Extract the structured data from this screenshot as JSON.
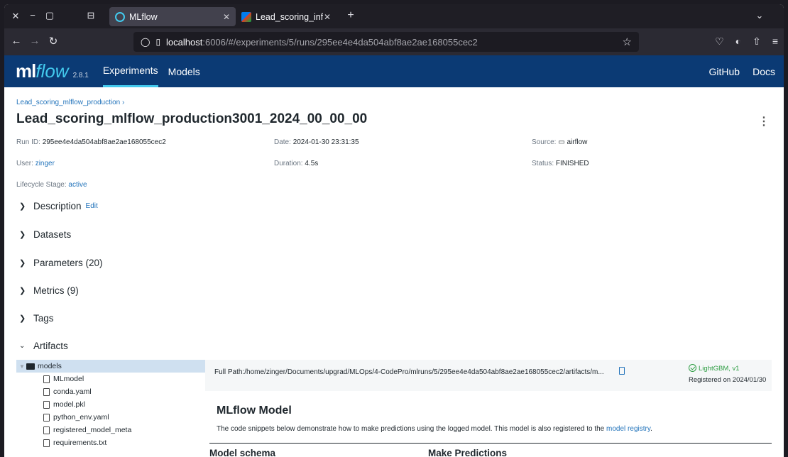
{
  "browser": {
    "tabs": [
      {
        "label": "MLflow",
        "active": true
      },
      {
        "label": "Lead_scoring_inference",
        "active": false
      }
    ],
    "url_host": "localhost",
    "url_rest": ":6006/#/experiments/5/runs/295ee4e4da504abf8ae2ae168055cec2"
  },
  "header": {
    "logo_ml": "ml",
    "logo_flow": "flow",
    "version": "2.8.1",
    "nav": [
      "Experiments",
      "Models"
    ],
    "right": [
      "GitHub",
      "Docs"
    ]
  },
  "run": {
    "breadcrumb": "Lead_scoring_mlflow_production",
    "title": "Lead_scoring_mlflow_production3001_2024_00_00_00",
    "run_id_label": "Run ID:",
    "run_id": "295ee4e4da504abf8ae2ae168055cec2",
    "date_label": "Date:",
    "date": "2024-01-30 23:31:35",
    "source_label": "Source:",
    "source": "airflow",
    "user_label": "User:",
    "user": "zinger",
    "duration_label": "Duration:",
    "duration": "4.5s",
    "status_label": "Status:",
    "status": "FINISHED",
    "lifecycle_label": "Lifecycle Stage:",
    "lifecycle": "active"
  },
  "sections": {
    "description": "Description",
    "edit": "Edit",
    "datasets": "Datasets",
    "parameters": "Parameters (20)",
    "metrics": "Metrics (9)",
    "tags": "Tags",
    "artifacts": "Artifacts"
  },
  "artifacts": {
    "folder": "models",
    "files": [
      "MLmodel",
      "conda.yaml",
      "model.pkl",
      "python_env.yaml",
      "registered_model_meta",
      "requirements.txt"
    ],
    "full_path": "Full Path:/home/zinger/Documents/upgrad/MLOps/4-CodePro/mlruns/5/295ee4e4da504abf8ae2ae168055cec2/artifacts/m...",
    "registered_model": "LightGBM, v1",
    "registered_on": "Registered on 2024/01/30",
    "model_title": "MLflow Model",
    "model_desc": "The code snippets below demonstrate how to make predictions using the logged model. This model is also registered to the",
    "model_registry_link": "model registry",
    "model_desc_end": ".",
    "schema_title": "Model schema",
    "predictions_title": "Make Predictions"
  },
  "colors": {
    "header_bg": "#0b3a74",
    "accent": "#43c9ed",
    "link": "#2374bb"
  }
}
